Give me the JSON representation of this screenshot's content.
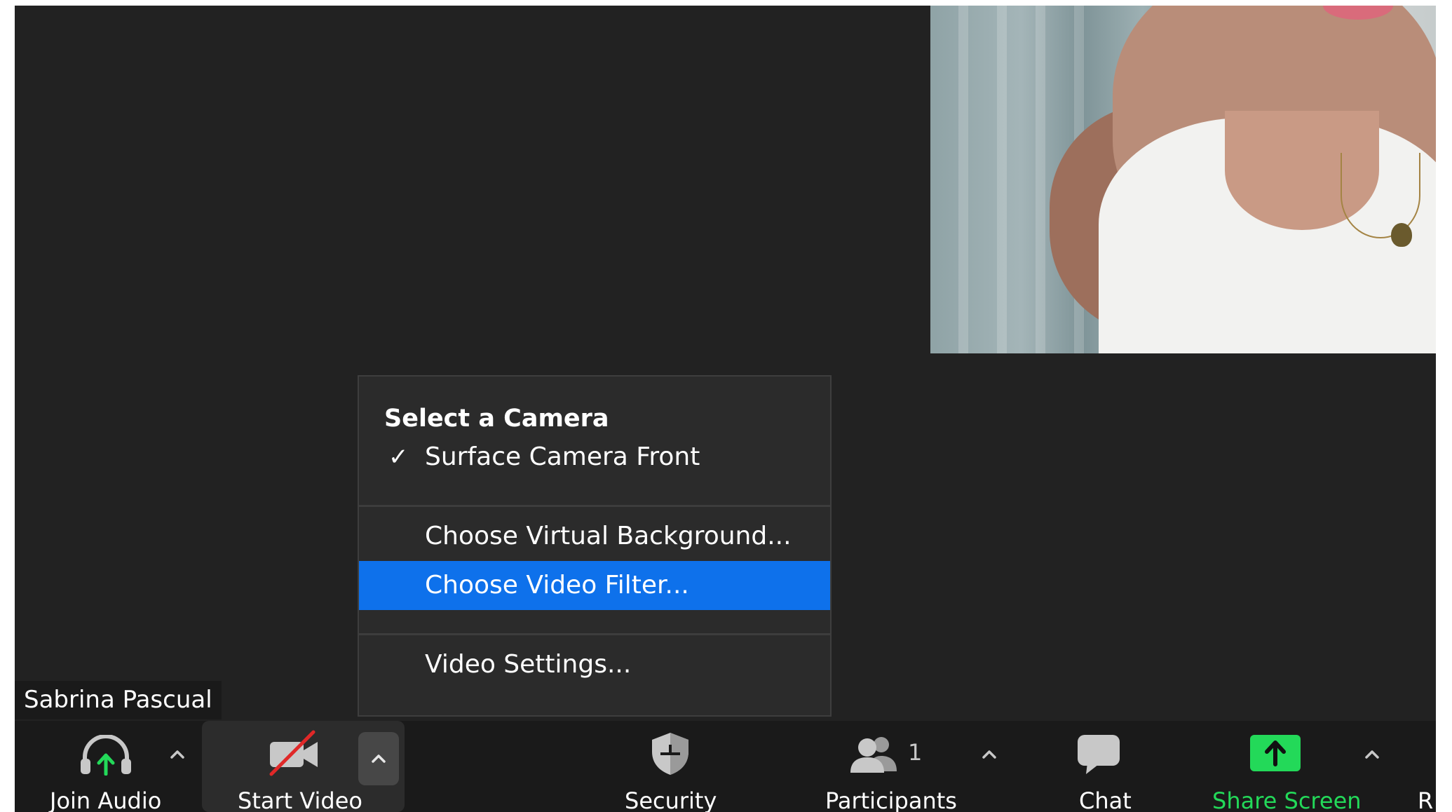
{
  "self_view": {
    "participant_name": "Sabrina Pascual"
  },
  "camera_menu": {
    "heading": "Select a Camera",
    "camera_options": [
      {
        "label": "Surface Camera Front",
        "selected": true
      }
    ],
    "items": [
      {
        "label": "Choose Virtual Background...",
        "highlighted": false
      },
      {
        "label": "Choose Video Filter...",
        "highlighted": true
      },
      {
        "label": "Video Settings...",
        "highlighted": false
      }
    ],
    "check_glyph": "✓"
  },
  "toolbar": {
    "join_audio": {
      "label": "Join Audio",
      "icon": "headphones-arrow-icon"
    },
    "start_video": {
      "label": "Start Video",
      "icon": "camera-off-icon"
    },
    "security": {
      "label": "Security",
      "icon": "shield-icon"
    },
    "participants": {
      "label": "Participants",
      "count": "1",
      "icon": "participants-icon"
    },
    "chat": {
      "label": "Chat",
      "icon": "chat-bubble-icon"
    },
    "share_screen": {
      "label": "Share Screen",
      "icon": "share-arrow-icon"
    },
    "more_label_fragment": "R"
  },
  "colors": {
    "background": "#222222",
    "toolbar": "#1a1a1a",
    "menu_highlight": "#0e71eb",
    "share_green": "#23d959",
    "camera_off_red": "#e02828"
  }
}
